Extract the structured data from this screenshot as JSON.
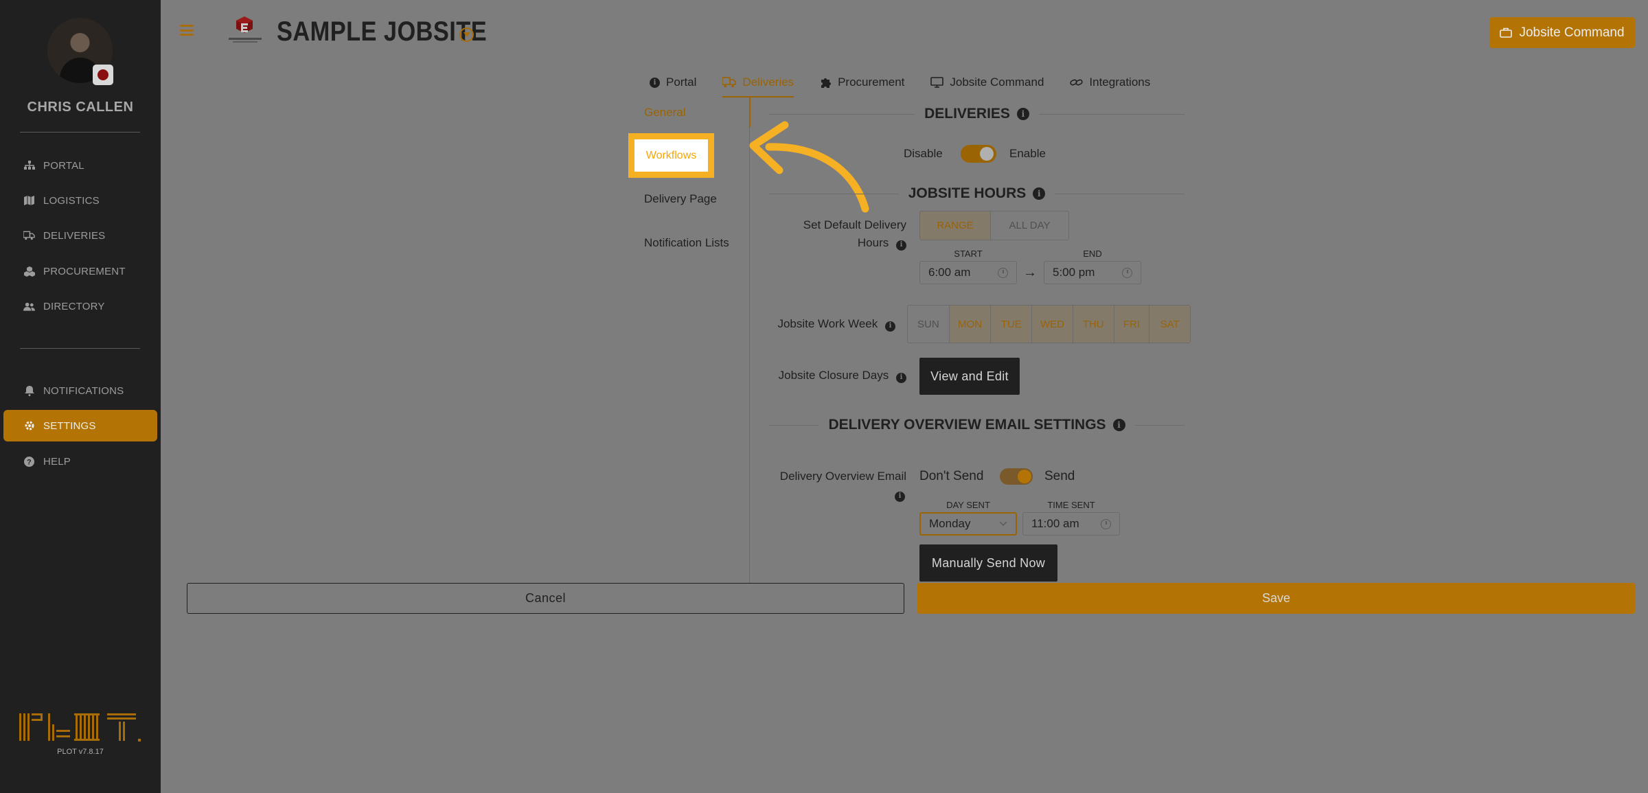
{
  "sidebar": {
    "user_name": "CHRIS CALLEN",
    "items": [
      {
        "label": "PORTAL",
        "icon": "sitemap-icon"
      },
      {
        "label": "LOGISTICS",
        "icon": "map-icon"
      },
      {
        "label": "DELIVERIES",
        "icon": "truck-icon"
      },
      {
        "label": "PROCUREMENT",
        "icon": "boxes-icon"
      },
      {
        "label": "DIRECTORY",
        "icon": "users-icon"
      },
      {
        "label": "NOTIFICATIONS",
        "icon": "bell-icon"
      },
      {
        "label": "SETTINGS",
        "icon": "gear-icon",
        "active": true
      },
      {
        "label": "HELP",
        "icon": "help-icon"
      }
    ],
    "version": "PLOT v7.8.17"
  },
  "header": {
    "title": "SAMPLE JOBSITE",
    "command_button": "Jobsite Command"
  },
  "tabs": [
    {
      "label": "Portal",
      "icon": "info-icon"
    },
    {
      "label": "Deliveries",
      "icon": "truck-icon",
      "active": true
    },
    {
      "label": "Procurement",
      "icon": "puzzle-icon"
    },
    {
      "label": "Jobsite Command",
      "icon": "monitor-icon"
    },
    {
      "label": "Integrations",
      "icon": "link-icon"
    }
  ],
  "subnav": {
    "general": "General",
    "workflows": "Workflows",
    "delivery_page": "Delivery Page",
    "notification_lists": "Notification Lists"
  },
  "deliveries": {
    "heading": "DELIVERIES",
    "disable": "Disable",
    "enable": "Enable"
  },
  "hours": {
    "heading": "JOBSITE HOURS",
    "default_label_1": "Set Default Delivery",
    "default_label_2": "Hours",
    "range": "RANGE",
    "all_day": "ALL DAY",
    "start_caption": "START",
    "end_caption": "END",
    "start_value": "6:00 am",
    "end_value": "5:00 pm",
    "arrow": "→",
    "work_week_label": "Jobsite Work Week",
    "days": [
      "SUN",
      "MON",
      "TUE",
      "WED",
      "THU",
      "FRI",
      "SAT"
    ],
    "closure_label": "Jobsite Closure Days",
    "view_edit": "View and Edit"
  },
  "email": {
    "heading": "DELIVERY OVERVIEW EMAIL SETTINGS",
    "label": "Delivery Overview Email",
    "dont_send": "Don't Send",
    "send": "Send",
    "day_caption": "DAY SENT",
    "day_value": "Monday",
    "time_caption": "TIME SENT",
    "time_value": "11:00 am",
    "manual": "Manually Send Now"
  },
  "footer": {
    "cancel": "Cancel",
    "save": "Save"
  },
  "colors": {
    "accent": "#b37405",
    "highlight": "#f6b023"
  }
}
